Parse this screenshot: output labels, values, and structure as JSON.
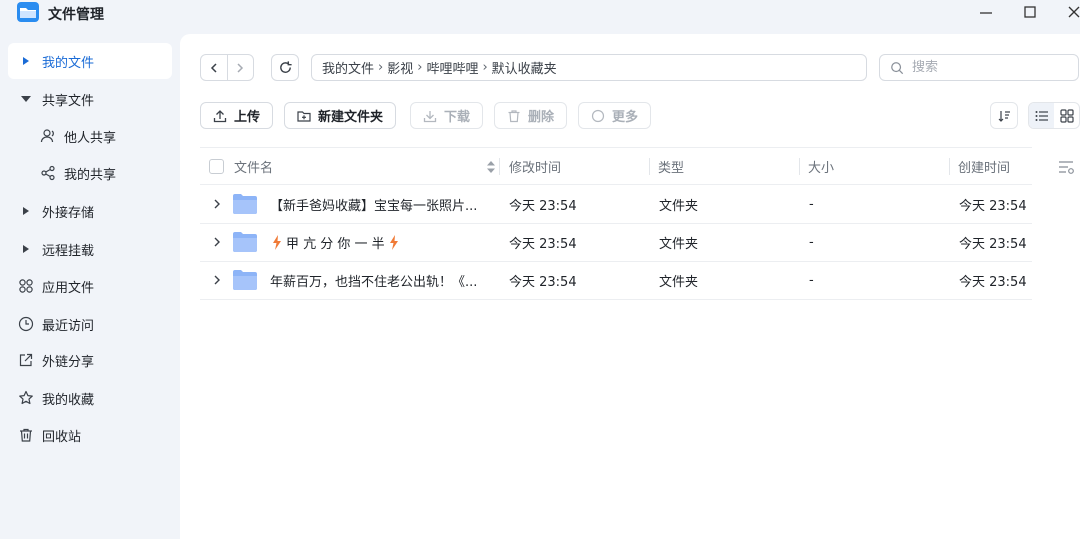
{
  "app": {
    "title": "文件管理"
  },
  "sidebar": {
    "items": [
      {
        "label": "我的文件",
        "icon": "caret-right-icon"
      },
      {
        "label": "共享文件",
        "icon": "caret-down-icon"
      },
      {
        "label": "他人共享",
        "icon": "user-share-icon"
      },
      {
        "label": "我的共享",
        "icon": "share-nodes-icon"
      },
      {
        "label": "外接存储",
        "icon": "caret-right-icon"
      },
      {
        "label": "远程挂载",
        "icon": "caret-right-icon"
      },
      {
        "label": "应用文件",
        "icon": "apps-grid-icon"
      },
      {
        "label": "最近访问",
        "icon": "clock-icon"
      },
      {
        "label": "外链分享",
        "icon": "external-link-icon"
      },
      {
        "label": "我的收藏",
        "icon": "star-icon"
      },
      {
        "label": "回收站",
        "icon": "trash-icon"
      }
    ]
  },
  "breadcrumb": [
    "我的文件",
    "影视",
    "哔哩哔哩",
    "默认收藏夹"
  ],
  "search": {
    "placeholder": "搜索"
  },
  "toolbar": {
    "upload": "上传",
    "new_folder": "新建文件夹",
    "download": "下载",
    "delete": "删除",
    "more": "更多"
  },
  "table": {
    "headers": {
      "name": "文件名",
      "modified": "修改时间",
      "type": "类型",
      "size": "大小",
      "created": "创建时间"
    },
    "rows": [
      {
        "name": "【新手爸妈收藏】宝宝每一张照片...",
        "modified": "今天 23:54",
        "type": "文件夹",
        "size": "-",
        "created": "今天 23:54"
      },
      {
        "name": "甲 亢 分 你 一 半",
        "modified": "今天 23:54",
        "type": "文件夹",
        "size": "-",
        "created": "今天 23:54"
      },
      {
        "name": "年薪百万，也挡不住老公出轨！《...",
        "modified": "今天 23:54",
        "type": "文件夹",
        "size": "-",
        "created": "今天 23:54"
      }
    ]
  },
  "colors": {
    "accent": "#1a6bd6",
    "folder": "#8db4f7",
    "lightning": "#f07a36"
  }
}
